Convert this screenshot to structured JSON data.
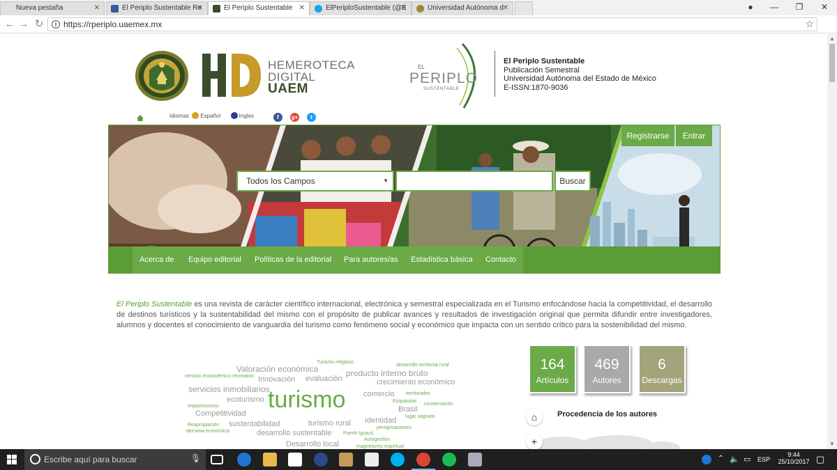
{
  "browser": {
    "tabs": [
      {
        "title": "Nueva pestaña",
        "active": false,
        "icon": "blank-page-icon"
      },
      {
        "title": "El Periplo Sustentable Re",
        "active": false,
        "icon": "facebook-icon"
      },
      {
        "title": "El Periplo Sustentable",
        "active": true,
        "icon": "hd-favicon-icon"
      },
      {
        "title": "ElPeriploSustentable (@E",
        "active": false,
        "icon": "twitter-icon"
      },
      {
        "title": "Universidad Autónoma d",
        "active": false,
        "icon": "uaem-favicon-icon"
      }
    ],
    "url": "https://rperiplo.uaemex.mx"
  },
  "header": {
    "hemeroteca_line1": "HEMEROTECA",
    "hemeroteca_line2": "DIGITAL",
    "hemeroteca_line3": "UAEM",
    "periplo_top": "EL",
    "periplo_word": "PERIPLO",
    "periplo_sub": "SUSTENTABLE",
    "pub_title": "El Periplo Sustentable",
    "pub_freq": "Publicación Semestral",
    "pub_univ": "Universidad Autónoma del Estado de México",
    "pub_issn": "E-ISSN:1870-9036"
  },
  "lang": {
    "label": "Idiomas",
    "es": "Español",
    "en": "Ingles"
  },
  "banner": {
    "register": "Registrarse",
    "login": "Entrar",
    "search_select": "Todos los Campos",
    "search_button": "Buscar",
    "search_value": ""
  },
  "nav": {
    "items": [
      "Acerca de",
      "Equipo editorial",
      "Políticas de la editorial",
      "Para autores/as",
      "Estadística básica",
      "Contacto"
    ]
  },
  "intro": {
    "journal": "El Periplo Sustentable",
    "text": " es una revista de carácter científico internacional, electrónica y semestral especializada en el Turismo enfocándose hacia la competitividad, el desarrollo de destinos turísticos y la sustentabilidad del mismo con el propósito de publicar avances y resultados de investigación original que permita difundir entre investigadores, alumnos y docentes el conocimiento de vanguardia del turismo como fenómeno social y económico que impacta con un sentido crítico para la sostenibilidad del mismo."
  },
  "wordcloud": [
    {
      "text": "Valoración económica",
      "tone": "gray"
    },
    {
      "text": "Turismo religioso",
      "tone": "green"
    },
    {
      "text": "desarrollo territorial rural",
      "tone": "green"
    },
    {
      "text": "servicio ecosistémico recreativo",
      "tone": "green"
    },
    {
      "text": "Innovación",
      "tone": "gray"
    },
    {
      "text": "evaluación",
      "tone": "gray"
    },
    {
      "text": "producto interno bruto",
      "tone": "gray"
    },
    {
      "text": "crecimiento económico",
      "tone": "gray"
    },
    {
      "text": "servicios inmobiliarios",
      "tone": "gray"
    },
    {
      "text": "comercio",
      "tone": "gray"
    },
    {
      "text": "territoriales",
      "tone": "green"
    },
    {
      "text": "ecoturismo",
      "tone": "gray"
    },
    {
      "text": "turismo",
      "tone": "green"
    },
    {
      "text": "Esquipulas",
      "tone": "green"
    },
    {
      "text": "conservación",
      "tone": "green"
    },
    {
      "text": "impactossocio",
      "tone": "green"
    },
    {
      "text": "Brasil",
      "tone": "gray"
    },
    {
      "text": "Competitividad",
      "tone": "gray"
    },
    {
      "text": "lugar sagrado",
      "tone": "green"
    },
    {
      "text": "Identidad",
      "tone": "gray"
    },
    {
      "text": "Reapropiación",
      "tone": "green"
    },
    {
      "text": "sustentabilidad",
      "tone": "gray"
    },
    {
      "text": "turismo rural",
      "tone": "gray"
    },
    {
      "text": "peregrinaciones",
      "tone": "green"
    },
    {
      "text": "derrama económica",
      "tone": "green"
    },
    {
      "text": "desarrollo sustentable",
      "tone": "gray"
    },
    {
      "text": "Puerto Iguazú",
      "tone": "green"
    },
    {
      "text": "Autogestión",
      "tone": "green"
    },
    {
      "text": "Desarrollo local",
      "tone": "gray"
    },
    {
      "text": "magnetismo espiritual",
      "tone": "green"
    }
  ],
  "stats": [
    {
      "value": "164",
      "label": "Artículos",
      "color": "#6aaa47"
    },
    {
      "value": "469",
      "label": "Autores",
      "color": "#a9a9a9"
    },
    {
      "value": "6",
      "label": "Descargas",
      "color": "#a3a47a"
    }
  ],
  "procedencia": {
    "title": "Procedencia de los autores",
    "home_icon": "home-icon",
    "zoom_icon": "zoom-in-icon"
  },
  "taskbar": {
    "search_placeholder": "Escribe aquí para buscar",
    "lang": "ESP",
    "time": "9:44",
    "date": "25/10/2017"
  },
  "colors": {
    "brand_green": "#6aaa47",
    "brand_green_dark": "#5a9d36",
    "hd_dark": "#3b4d2b"
  }
}
